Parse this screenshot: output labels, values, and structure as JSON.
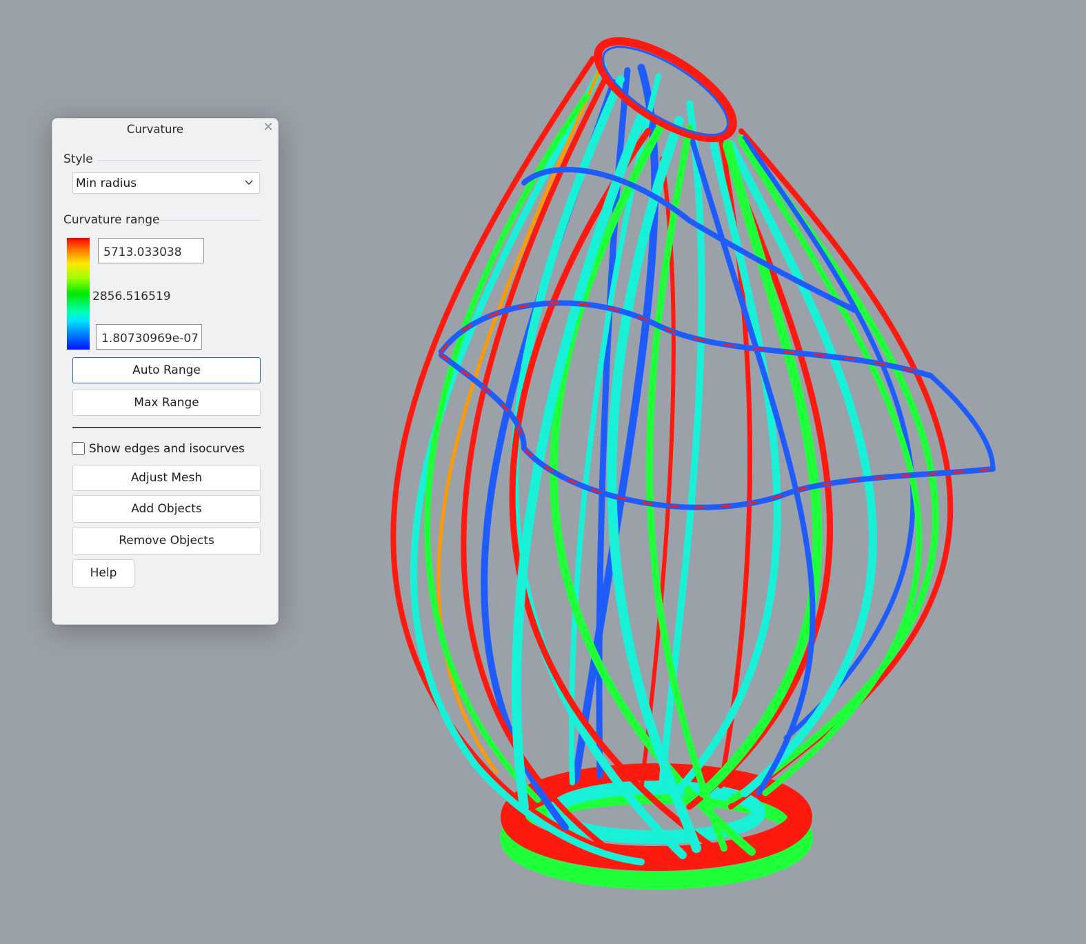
{
  "panel": {
    "title": "Curvature",
    "close_icon": "close-icon",
    "style_label": "Style",
    "style_value": "Min radius",
    "range_label": "Curvature range",
    "range_max": "5713.033038",
    "range_mid": "2856.516519",
    "range_min": "1.80730969e-07",
    "auto_range_label": "Auto Range",
    "max_range_label": "Max Range",
    "show_edges_label": "Show edges and isocurves",
    "show_edges_checked": false,
    "adjust_mesh_label": "Adjust Mesh",
    "add_objects_label": "Add Objects",
    "remove_objects_label": "Remove Objects",
    "help_label": "Help"
  },
  "colors": {
    "viewport_background": "#9ba1a8",
    "curvature_red": "#ff1a10",
    "curvature_green": "#1fff3a",
    "curvature_cyan": "#18f0d8",
    "curvature_blue": "#1f5cff",
    "accent_border": "#2c6fb6"
  }
}
